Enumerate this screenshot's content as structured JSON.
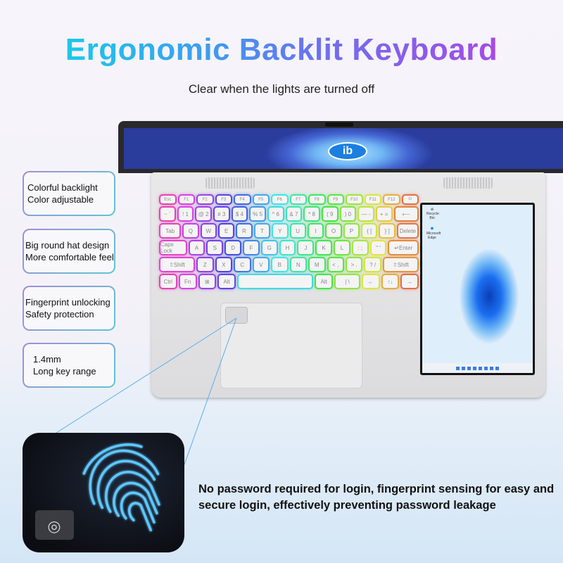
{
  "header": {
    "title": "Ergonomic Backlit Keyboard",
    "subtitle": "Clear when the lights are turned off"
  },
  "features": [
    {
      "line1": "Colorful backlight",
      "line2": "Color adjustable"
    },
    {
      "line1": "Big round hat design",
      "line2": "More comfortable feel"
    },
    {
      "line1": "Fingerprint unlocking",
      "line2": "Safety protection"
    },
    {
      "line1": "1.4mm",
      "line2": "Long key range"
    }
  ],
  "laptop": {
    "keyboard_rows": [
      [
        "Esc",
        "F1",
        "F2",
        "F3",
        "F4",
        "F5",
        "F6",
        "F7",
        "F8",
        "F9",
        "F10",
        "F11",
        "F12",
        "⏻"
      ],
      [
        "~ `",
        "! 1",
        "@ 2",
        "# 3",
        "$ 4",
        "% 5",
        "^ 6",
        "& 7",
        "* 8",
        "( 9",
        ") 0",
        "— -",
        "+ =",
        "⟵"
      ],
      [
        "Tab",
        "Q",
        "W",
        "E",
        "R",
        "T",
        "Y",
        "U",
        "I",
        "O",
        "P",
        "{ [",
        "} ]",
        "Delete"
      ],
      [
        "Caps Lock",
        "A",
        "S",
        "D",
        "F",
        "G",
        "H",
        "J",
        "K",
        "L",
        ": ;",
        "\" '",
        "↵Enter"
      ],
      [
        "⇧Shift",
        "Z",
        "X",
        "C",
        "V",
        "B",
        "N",
        "M",
        "< ,",
        "> .",
        "? /",
        "⇧Shift"
      ],
      [
        "Ctrl",
        "Fn",
        "⊞",
        "Alt",
        "",
        "Alt",
        "| \\",
        "←",
        "↑↓",
        "→"
      ]
    ],
    "screen_logo": "ib",
    "desktop_icons": [
      "Recycle Bin",
      "Microsoft Edge"
    ],
    "backlight_colors": [
      "#e8609a",
      "#4a4ad8",
      "#4ac8e8",
      "#5ad85a",
      "#e8d84a",
      "#e8643a"
    ]
  },
  "fingerprint_description": "No password required for login, fingerprint sensing for easy and secure login, effectively preventing password leakage"
}
